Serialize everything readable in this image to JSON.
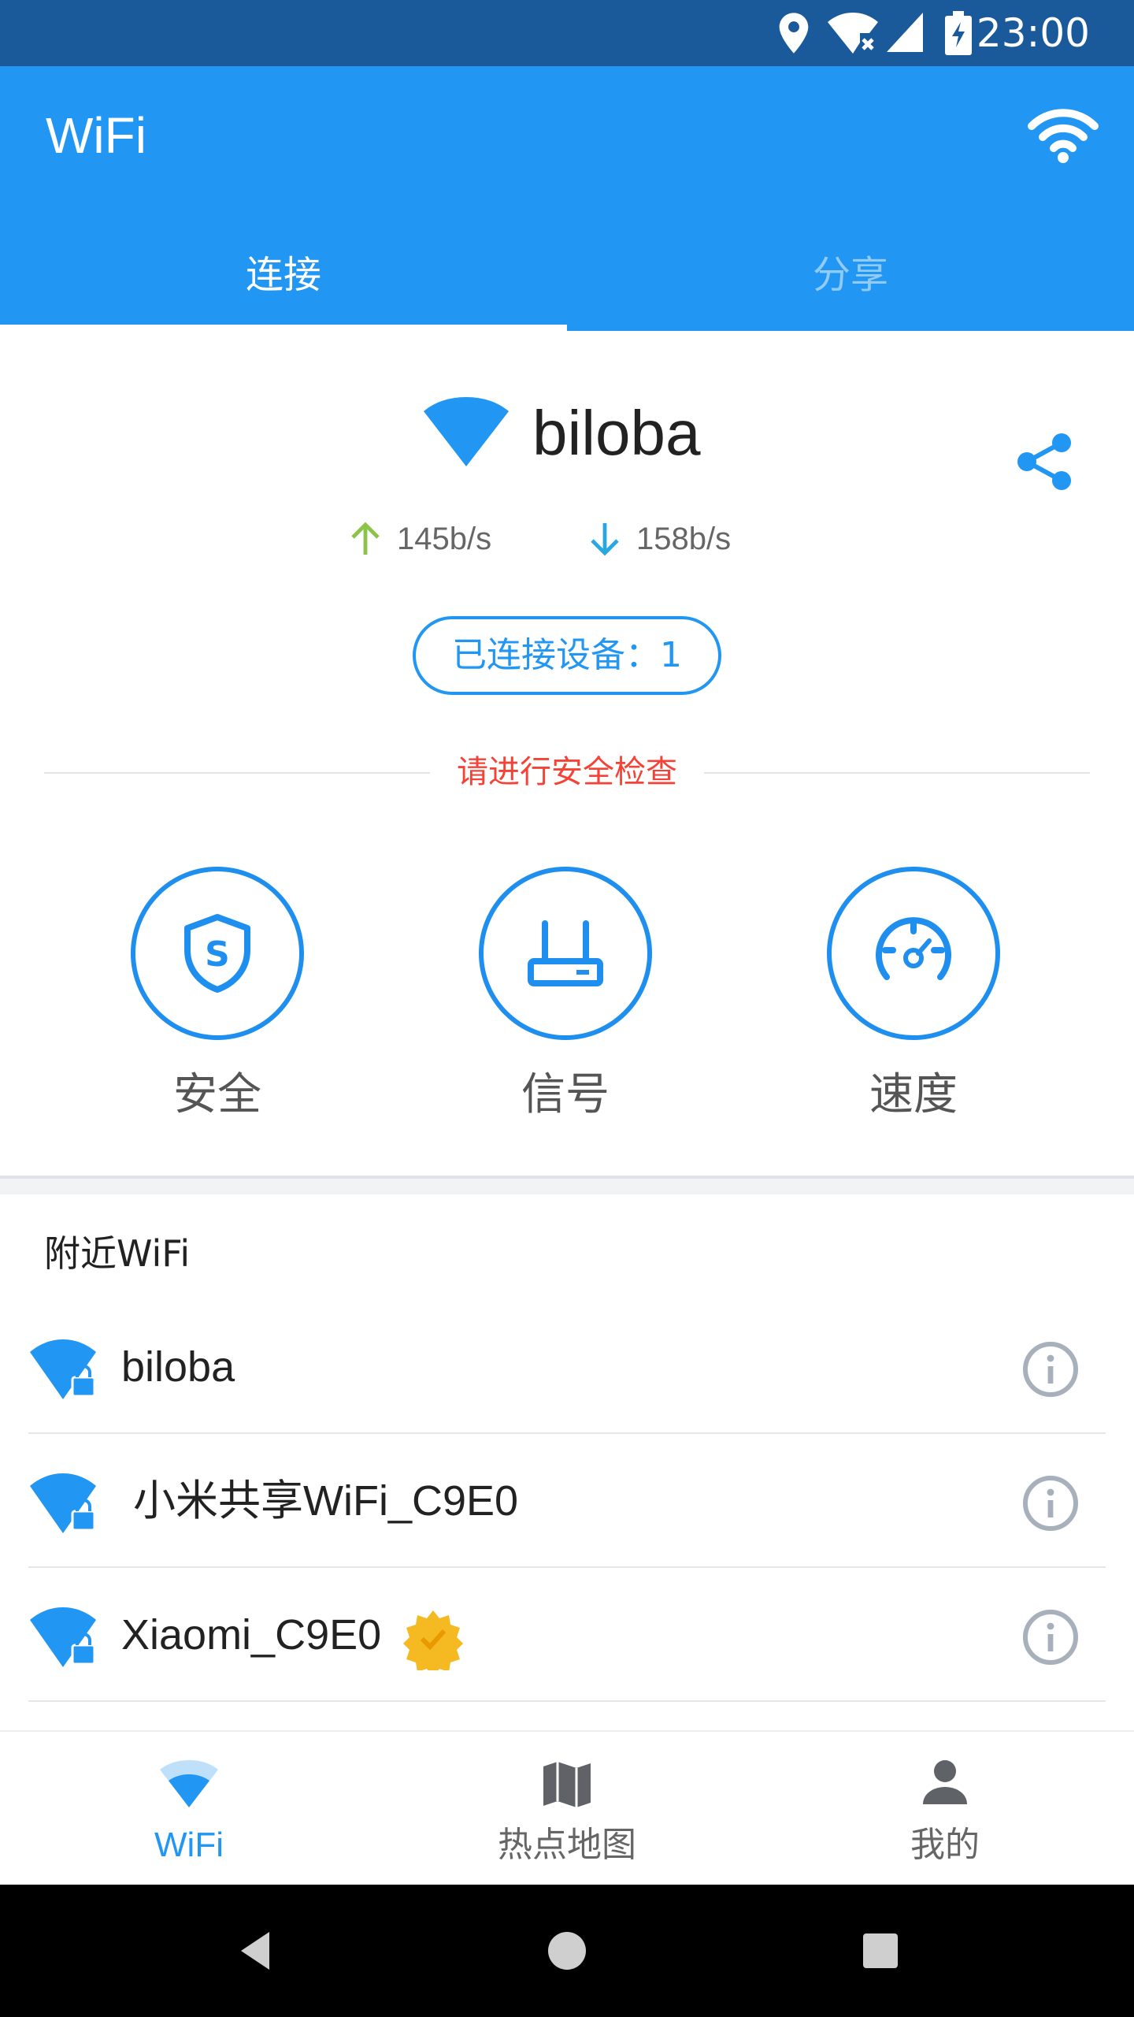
{
  "status_bar": {
    "time": "23:00",
    "icons": [
      "location-icon",
      "wifi-no-internet-icon",
      "cell-signal-icon",
      "battery-charging-icon"
    ]
  },
  "app_bar": {
    "title": "WiFi",
    "action_icon": "wifi-icon",
    "color": "#2196f3"
  },
  "tabs": [
    {
      "label": "连接",
      "active": true
    },
    {
      "label": "分享",
      "active": false
    }
  ],
  "connection": {
    "ssid": "biloba",
    "upload_speed": "145b/s",
    "download_speed": "158b/s",
    "devices_label": "已连接设备：1",
    "security_hint": "请进行安全检查",
    "hint_color": "#f44336"
  },
  "tools": [
    {
      "label": "安全",
      "icon": "shield-s-icon"
    },
    {
      "label": "信号",
      "icon": "router-icon"
    },
    {
      "label": "速度",
      "icon": "speedometer-icon"
    }
  ],
  "nearby": {
    "header": "附近WiFi",
    "items": [
      {
        "name": "biloba",
        "locked": true,
        "verified": false
      },
      {
        "name": " 小米共享WiFi_C9E0",
        "locked": true,
        "verified": false
      },
      {
        "name": "Xiaomi_C9E0",
        "locked": true,
        "verified": true
      }
    ]
  },
  "bottom_nav": [
    {
      "label": "WiFi",
      "icon": "wifi-icon",
      "active": true
    },
    {
      "label": "热点地图",
      "icon": "map-icon",
      "active": false
    },
    {
      "label": "我的",
      "icon": "person-icon",
      "active": false
    }
  ],
  "colors": {
    "accent": "#2196f3",
    "upload_arrow": "#8bc34a",
    "download_arrow": "#29a8e0"
  }
}
